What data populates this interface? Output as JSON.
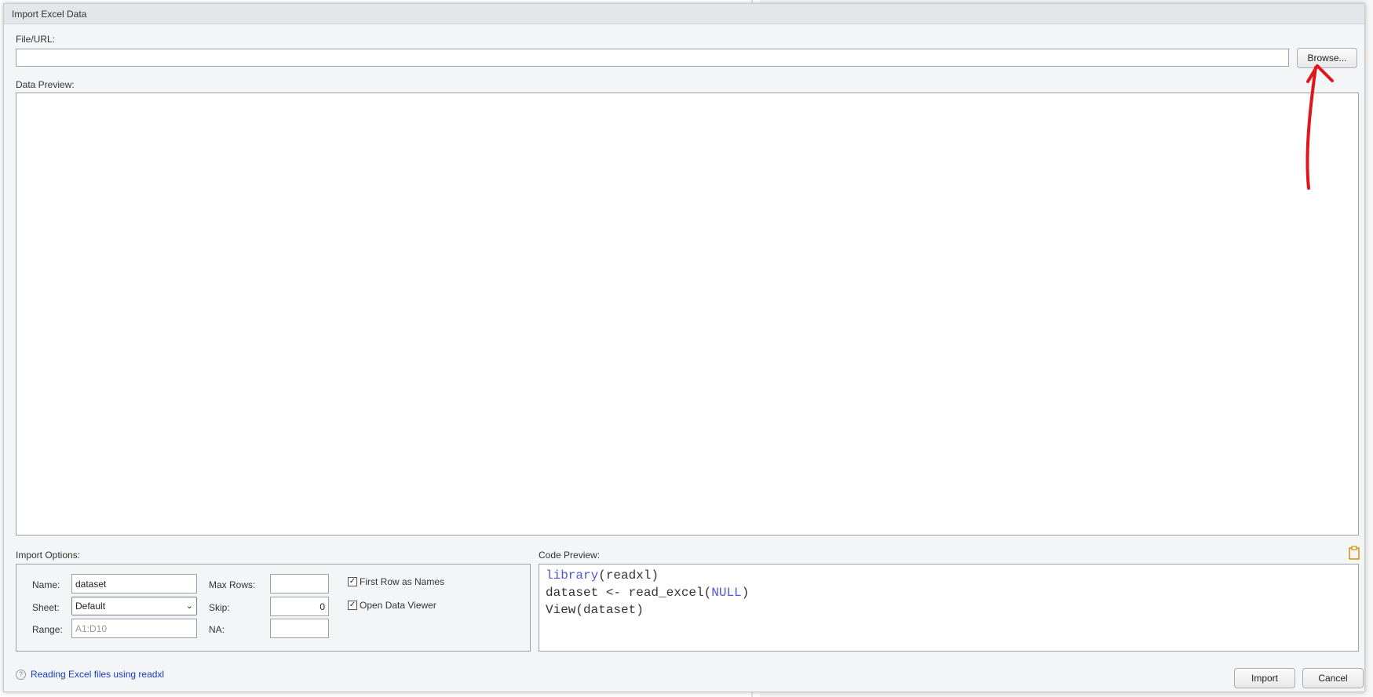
{
  "dialog": {
    "title": "Import Excel Data"
  },
  "file": {
    "label": "File/URL:",
    "value": "",
    "browse_label": "Browse..."
  },
  "preview": {
    "label": "Data Preview:"
  },
  "import_options": {
    "label": "Import Options:",
    "name_label": "Name:",
    "name_value": "dataset",
    "sheet_label": "Sheet:",
    "sheet_value": "Default",
    "range_label": "Range:",
    "range_placeholder": "A1:D10",
    "max_rows_label": "Max Rows:",
    "max_rows_value": "",
    "skip_label": "Skip:",
    "skip_value": "0",
    "na_label": "NA:",
    "na_value": "",
    "first_row_label": "First Row as Names",
    "first_row_checked": true,
    "open_viewer_label": "Open Data Viewer",
    "open_viewer_checked": true
  },
  "code_preview": {
    "label": "Code Preview:",
    "line1_kw": "library",
    "line1_rest": "(readxl)",
    "line2_pre": "dataset <- read_excel(",
    "line2_kw": "NULL",
    "line2_post": ")",
    "line3": "View(dataset)",
    "keyword_color": "#4d59d6"
  },
  "footer": {
    "help_icon": "?",
    "help_text": "Reading Excel files using readxl",
    "import_label": "Import",
    "cancel_label": "Cancel"
  },
  "annotation": {
    "arrow_color": "#e0161b"
  }
}
